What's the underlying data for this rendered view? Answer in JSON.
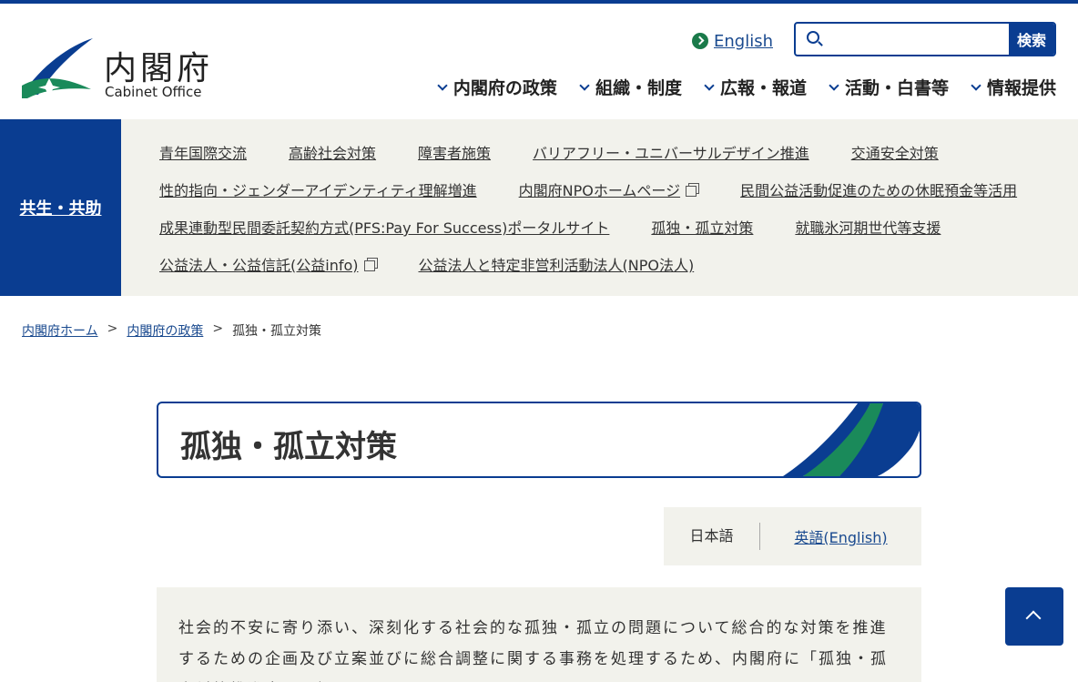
{
  "header": {
    "logo_jp": "内閣府",
    "logo_en": "Cabinet Office",
    "english_link": "English",
    "search": {
      "placeholder": "",
      "button": "検索"
    },
    "nav": [
      {
        "label": "内閣府の政策"
      },
      {
        "label": "組織・制度"
      },
      {
        "label": "広報・報道"
      },
      {
        "label": "活動・白書等"
      },
      {
        "label": "情報提供"
      }
    ]
  },
  "submenu": {
    "category": "共生・共助",
    "rows": [
      [
        {
          "label": "青年国際交流"
        },
        {
          "label": "高齢社会対策"
        },
        {
          "label": "障害者施策"
        },
        {
          "label": "バリアフリー・ユニバーサルデザイン推進"
        },
        {
          "label": "交通安全対策"
        }
      ],
      [
        {
          "label": "性的指向・ジェンダーアイデンティティ理解増進"
        },
        {
          "label": "内閣府NPOホームページ",
          "external": true
        },
        {
          "label": "民間公益活動促進のための休眠預金等活用"
        }
      ],
      [
        {
          "label": "成果連動型民間委託契約方式(PFS:Pay For Success)ポータルサイト"
        },
        {
          "label": "孤独・孤立対策"
        },
        {
          "label": "就職氷河期世代等支援"
        }
      ],
      [
        {
          "label": "公益法人・公益信託(公益info)",
          "external": true
        },
        {
          "label": "公益法人と特定非営利活動法人(NPO法人)"
        }
      ]
    ]
  },
  "breadcrumb": {
    "home": "内閣府ホーム",
    "sep": ">",
    "parent": "内閣府の政策",
    "current": "孤独・孤立対策"
  },
  "page": {
    "title": "孤独・孤立対策",
    "lang_current": "日本語",
    "lang_english": "英語(English)",
    "intro": "社会的不安に寄り添い、深刻化する社会的な孤独・孤立の問題について総合的な対策を推進するための企画及び立案並びに総合調整に関する事務を処理するため、内閣府に「孤独・孤立対策推進室」を設置しています。"
  },
  "colors": {
    "primary": "#0a3d91",
    "accent_green": "#1a7a4a",
    "panel_bg": "#f2f2ec"
  }
}
